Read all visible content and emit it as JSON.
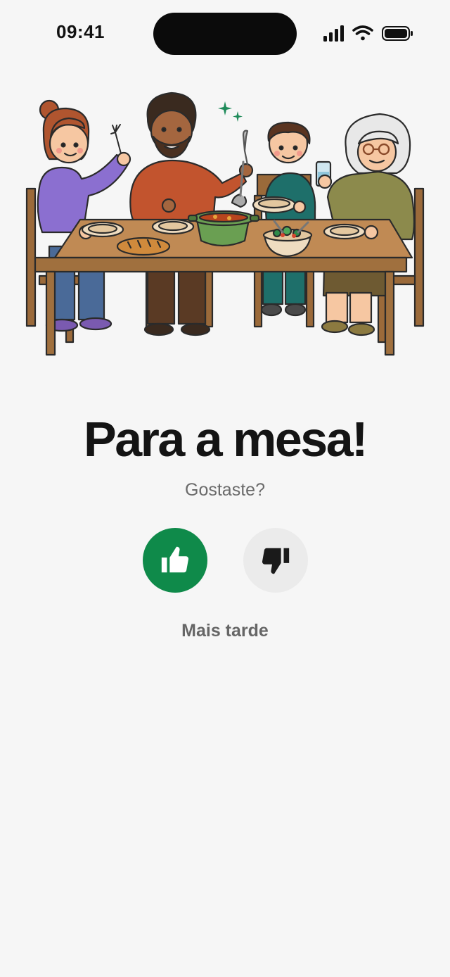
{
  "status_bar": {
    "time": "09:41",
    "icons": [
      "signal-icon",
      "wifi-icon",
      "battery-icon"
    ]
  },
  "illustration": {
    "subject": "family-dinner-illustration"
  },
  "screen": {
    "title": "Para a mesa!",
    "subtitle": "Gostaste?",
    "like_icon": "thumbs-up-icon",
    "dislike_icon": "thumbs-down-icon",
    "later_label": "Mais tarde"
  },
  "colors": {
    "background": "#f6f6f6",
    "like_button": "#0f8a4a",
    "dislike_button": "#ebebeb",
    "title": "#141414",
    "subtitle": "#6b6b6b"
  }
}
